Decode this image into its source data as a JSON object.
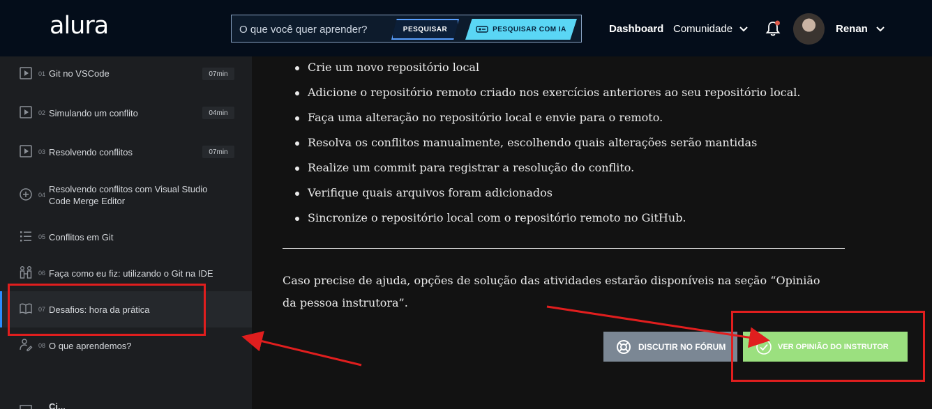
{
  "header": {
    "logo": "alura",
    "search_placeholder": "O que você quer aprender?",
    "search_button": "PESQUISAR",
    "search_ai_button": "PESQUISAR COM IA",
    "nav_dashboard": "Dashboard",
    "nav_community": "Comunidade",
    "user_name": "Renan",
    "notification_dot_color": "#e05a4a"
  },
  "sidebar": {
    "items": [
      {
        "num": "01",
        "title": "Git no VSCode",
        "duration": "07min",
        "icon": "play-icon"
      },
      {
        "num": "02",
        "title": "Simulando um conflito",
        "duration": "04min",
        "icon": "play-icon"
      },
      {
        "num": "03",
        "title": "Resolvendo conflitos",
        "duration": "07min",
        "icon": "play-icon"
      },
      {
        "num": "04",
        "title": "Resolvendo conflitos com Visual Studio Code Merge Editor",
        "icon": "plus-circle-icon"
      },
      {
        "num": "05",
        "title": "Conflitos em Git",
        "icon": "list-icon"
      },
      {
        "num": "06",
        "title": "Faça como eu fiz: utilizando o Git na IDE",
        "icon": "hands-on-icon"
      },
      {
        "num": "07",
        "title": "Desafios: hora da prática",
        "icon": "book-icon",
        "active": true
      },
      {
        "num": "08",
        "title": "O que aprendemos?",
        "icon": "person-edit-icon"
      }
    ],
    "partial_next": "Ci..."
  },
  "content": {
    "tasks": [
      "Crie um novo repositório local",
      "Adicione o repositório remoto criado nos exercícios anteriores ao seu repositório local.",
      "Faça uma alteração no repositório local e envie para o remoto.",
      "Resolva os conflitos manualmente, escolhendo quais alterações serão mantidas",
      "Realize um commit para registrar a resolução do conflito.",
      "Verifique quais arquivos foram adicionados",
      "Sincronize o repositório local com o repositório remoto no GitHub."
    ],
    "help_text": "Caso precise de ajuda, opções de solução das atividades estarão disponíveis na seção “Opinião da pessoa instrutora”.",
    "forum_button": "DISCUTIR NO FÓRUM",
    "opinion_button": "VER OPINIÃO DO INSTRUTOR"
  },
  "colors": {
    "header_bg": "#040d1a",
    "sidebar_bg": "#1c1e21",
    "content_bg": "#121212",
    "accent_blue": "#2a8cff",
    "forum_button": "#7b8794",
    "opinion_button": "#9be07f",
    "annotation_red": "#e01e1e"
  }
}
